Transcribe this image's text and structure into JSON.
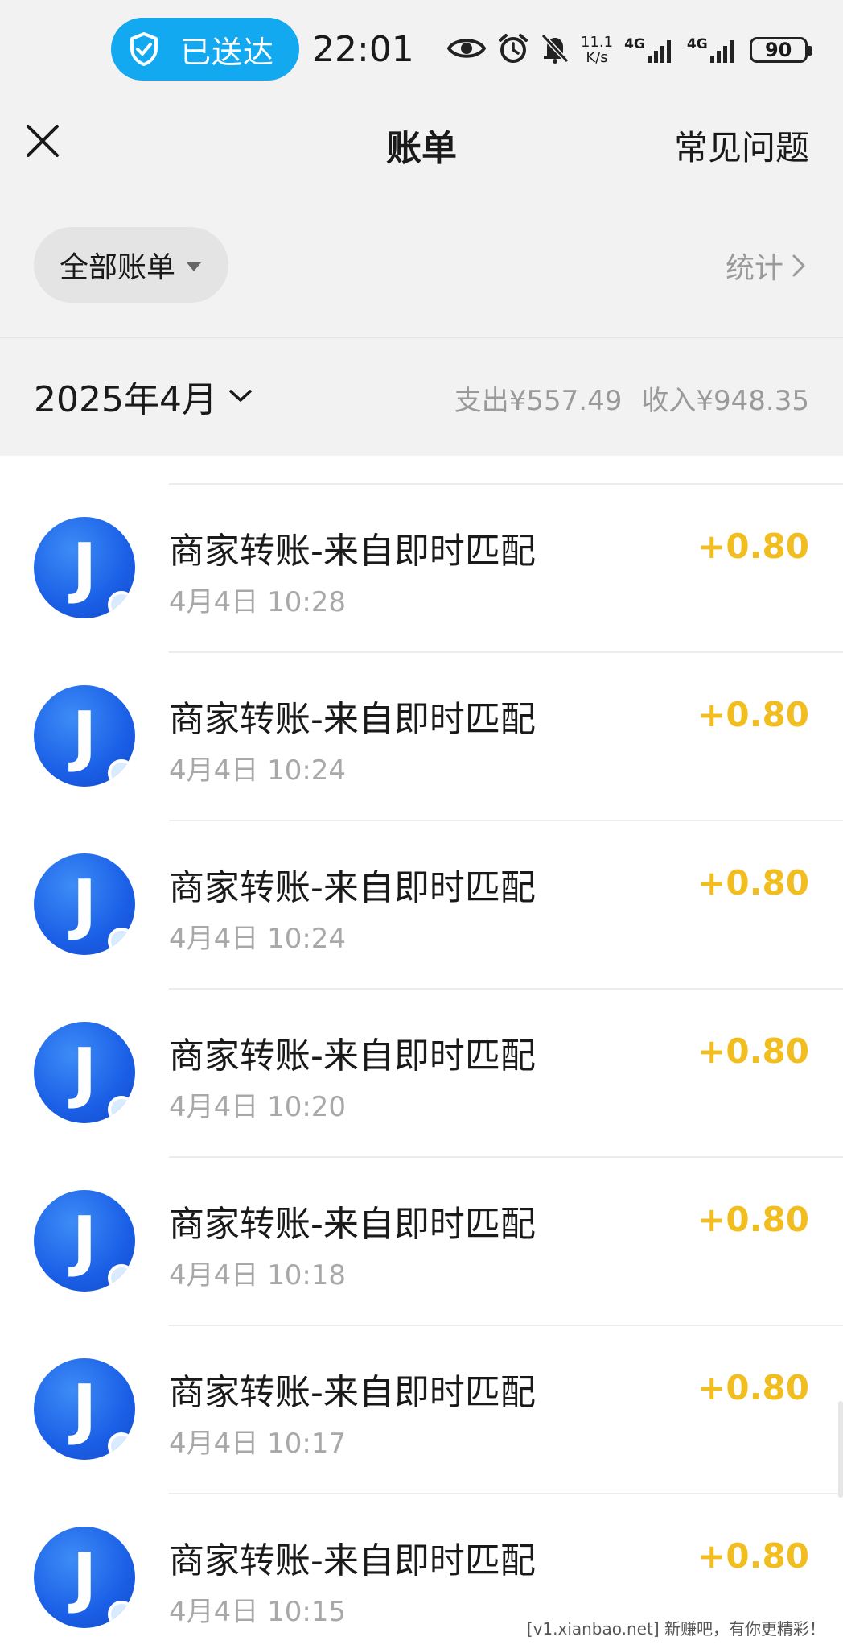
{
  "status_bar": {
    "sent_label": "已送达",
    "time": "22:01",
    "speed_value": "11.1",
    "speed_unit": "K/s",
    "network1": "4G",
    "network2": "4G",
    "battery": "90"
  },
  "header": {
    "title": "账单",
    "faq": "常见问题"
  },
  "filter": {
    "label": "全部账单",
    "stats": "统计"
  },
  "month": {
    "label": "2025年4月",
    "expense": "支出¥557.49",
    "income": "收入¥948.35"
  },
  "avatar_letter": "J",
  "bills": [
    {
      "title": "商家转账-来自即时匹配",
      "time": "4月4日 10:28",
      "amount": "+0.80"
    },
    {
      "title": "商家转账-来自即时匹配",
      "time": "4月4日 10:24",
      "amount": "+0.80"
    },
    {
      "title": "商家转账-来自即时匹配",
      "time": "4月4日 10:24",
      "amount": "+0.80"
    },
    {
      "title": "商家转账-来自即时匹配",
      "time": "4月4日 10:20",
      "amount": "+0.80"
    },
    {
      "title": "商家转账-来自即时匹配",
      "time": "4月4日 10:18",
      "amount": "+0.80"
    },
    {
      "title": "商家转账-来自即时匹配",
      "time": "4月4日 10:17",
      "amount": "+0.80"
    },
    {
      "title": "商家转账-来自即时匹配",
      "time": "4月4日 10:15",
      "amount": "+0.80"
    }
  ],
  "watermark": "[v1.xianbao.net] 新赚吧，有你更精彩！",
  "colors": {
    "pill_blue": "#12a9f0",
    "amount_yellow": "#f2bd1e",
    "avatar_blue": "#1a5fe6"
  }
}
